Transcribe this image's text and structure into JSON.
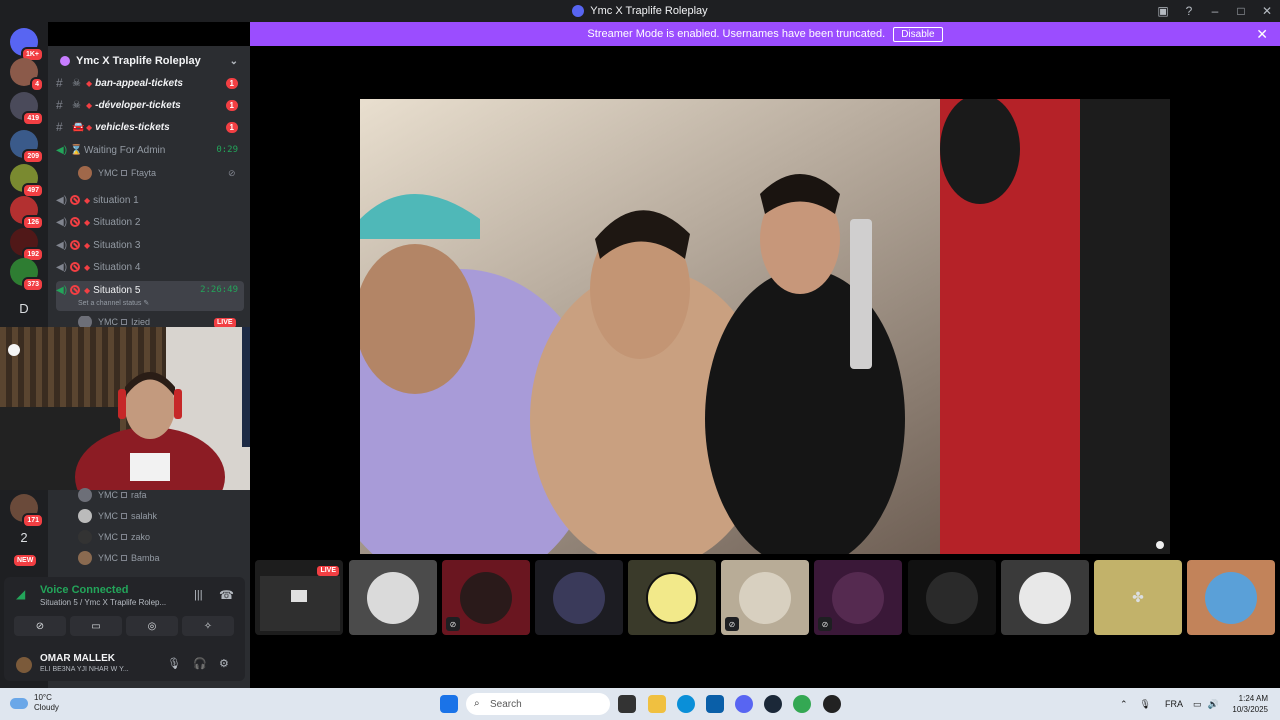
{
  "window": {
    "title": "Ymc X Traplife Roleplay"
  },
  "banner": {
    "text": "Streamer Mode is enabled. Usernames have been truncated.",
    "button": "Disable"
  },
  "servers": [
    {
      "badge": "1K+"
    },
    {
      "badge": "4"
    },
    {
      "badge": "419"
    },
    {
      "badge": "209"
    },
    {
      "badge": "497"
    },
    {
      "badge": "126"
    },
    {
      "badge": "192"
    },
    {
      "badge": "373"
    },
    {
      "letter": "D"
    },
    {
      "badge": "171"
    },
    {
      "letter": "2"
    },
    {
      "badge": "NEW"
    }
  ],
  "guild": {
    "name": "Ymc X Traplife Roleplay"
  },
  "channels": [
    {
      "name": "ban-appeal-tickets",
      "badge": "1"
    },
    {
      "name": "-déveloper-tickets",
      "badge": "1"
    },
    {
      "name": "vehicles-tickets",
      "badge": "1"
    }
  ],
  "voice_channels": {
    "waiting": {
      "name": "Waiting For Admin",
      "timer": "0:29",
      "member_tag": "YMC",
      "member": "Ftayta"
    },
    "situations": [
      "situation 1",
      "Situation 2",
      "Situation 3",
      "Situation 4"
    ],
    "active": {
      "name": "Situation 5",
      "timer": "2:26:49",
      "status": "Set a channel status",
      "member_tag": "YMC",
      "member": "Izied",
      "live": "LIVE"
    }
  },
  "members_below": [
    {
      "tag": "YMC",
      "name": "rafa"
    },
    {
      "tag": "YMC",
      "name": "salahk"
    },
    {
      "tag": "YMC",
      "name": "zako"
    },
    {
      "tag": "YMC",
      "name": "Bamba"
    }
  ],
  "voice_panel": {
    "title": "Voice Connected",
    "subtitle": "Situation 5 / Ymc X Traplife Rolep..."
  },
  "user": {
    "name": "OMAR MALLEK",
    "status": "ELI BE3NA YJI NHAR W Y..."
  },
  "tiles": {
    "live_label": "LIVE"
  },
  "taskbar": {
    "weather_temp": "10°C",
    "weather_desc": "Cloudy",
    "search_placeholder": "Search",
    "lang": "FRA",
    "time": "1:24 AM",
    "date": "10/3/2025"
  },
  "colors": {
    "accent": "#5865f2",
    "banner": "#9b4dff",
    "live": "#f23f43",
    "connected": "#23a55a"
  }
}
